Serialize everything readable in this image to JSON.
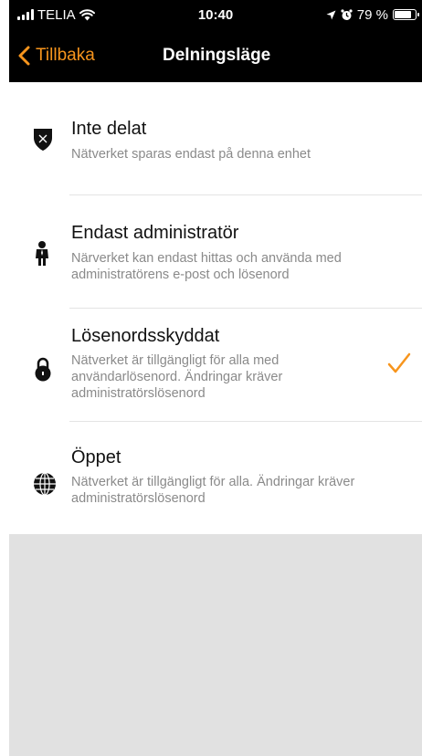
{
  "status_bar": {
    "carrier": "TELIA",
    "time": "10:40",
    "battery_percent": "79 %",
    "battery_level": 0.79
  },
  "nav": {
    "back_label": "Tillbaka",
    "title": "Delningsläge"
  },
  "options": [
    {
      "title": "Inte delat",
      "description": "Nätverket sparas endast på denna enhet",
      "icon": "shield-icon",
      "selected": false
    },
    {
      "title": "Endast administratör",
      "description": "Närverket kan endast hittas och använda med administratörens e-post och lösenord",
      "icon": "person-icon",
      "selected": false
    },
    {
      "title": "Lösenordsskyddat",
      "description": "Nätverket är tillgängligt för alla med användarlösenord. Ändringar kräver administratörslösenord",
      "icon": "lock-icon",
      "selected": true
    },
    {
      "title": "Öppet",
      "description": "Nätverket är tillgängligt för alla. Ändringar kräver administratörslösenord",
      "icon": "globe-icon",
      "selected": false
    }
  ],
  "colors": {
    "accent": "#f7951d",
    "bar_background": "#000000",
    "empty_area": "#e1e1e1"
  }
}
